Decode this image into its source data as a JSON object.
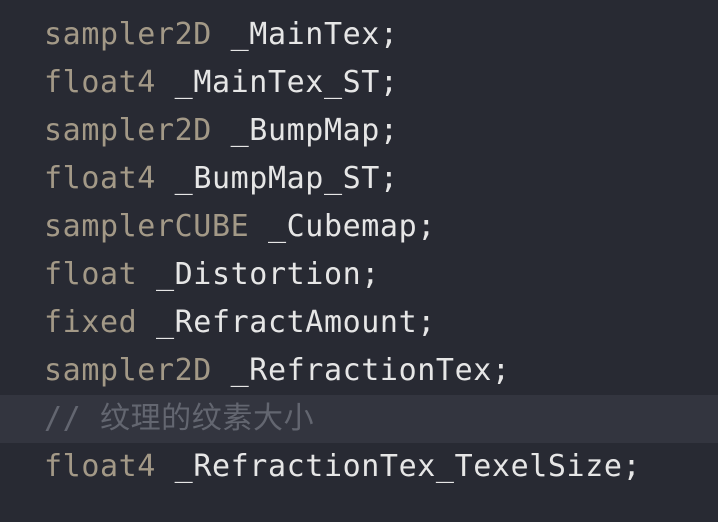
{
  "editor": {
    "lines": [
      {
        "type": "sampler2D",
        "ident": "_MainTex;"
      },
      {
        "type": "float4",
        "ident": "_MainTex_ST;"
      },
      {
        "type": "sampler2D",
        "ident": "_BumpMap;"
      },
      {
        "type": "float4",
        "ident": "_BumpMap_ST;"
      },
      {
        "type": "samplerCUBE",
        "ident": "_Cubemap;"
      },
      {
        "type": "float",
        "ident": "_Distortion;"
      },
      {
        "type": "fixed",
        "ident": "_RefractAmount;"
      },
      {
        "type": "sampler2D",
        "ident": "_RefractionTex;"
      },
      {
        "comment": "// 纹理的纹素大小"
      },
      {
        "type": "float4",
        "ident": "_RefractionTex_TexelSize;"
      }
    ],
    "current_line_index": 8
  },
  "colors": {
    "background": "#282a33",
    "current_line": "#33353f",
    "type_keyword": "#a39987",
    "identifier": "#e6e6e6",
    "comment": "#636670"
  }
}
